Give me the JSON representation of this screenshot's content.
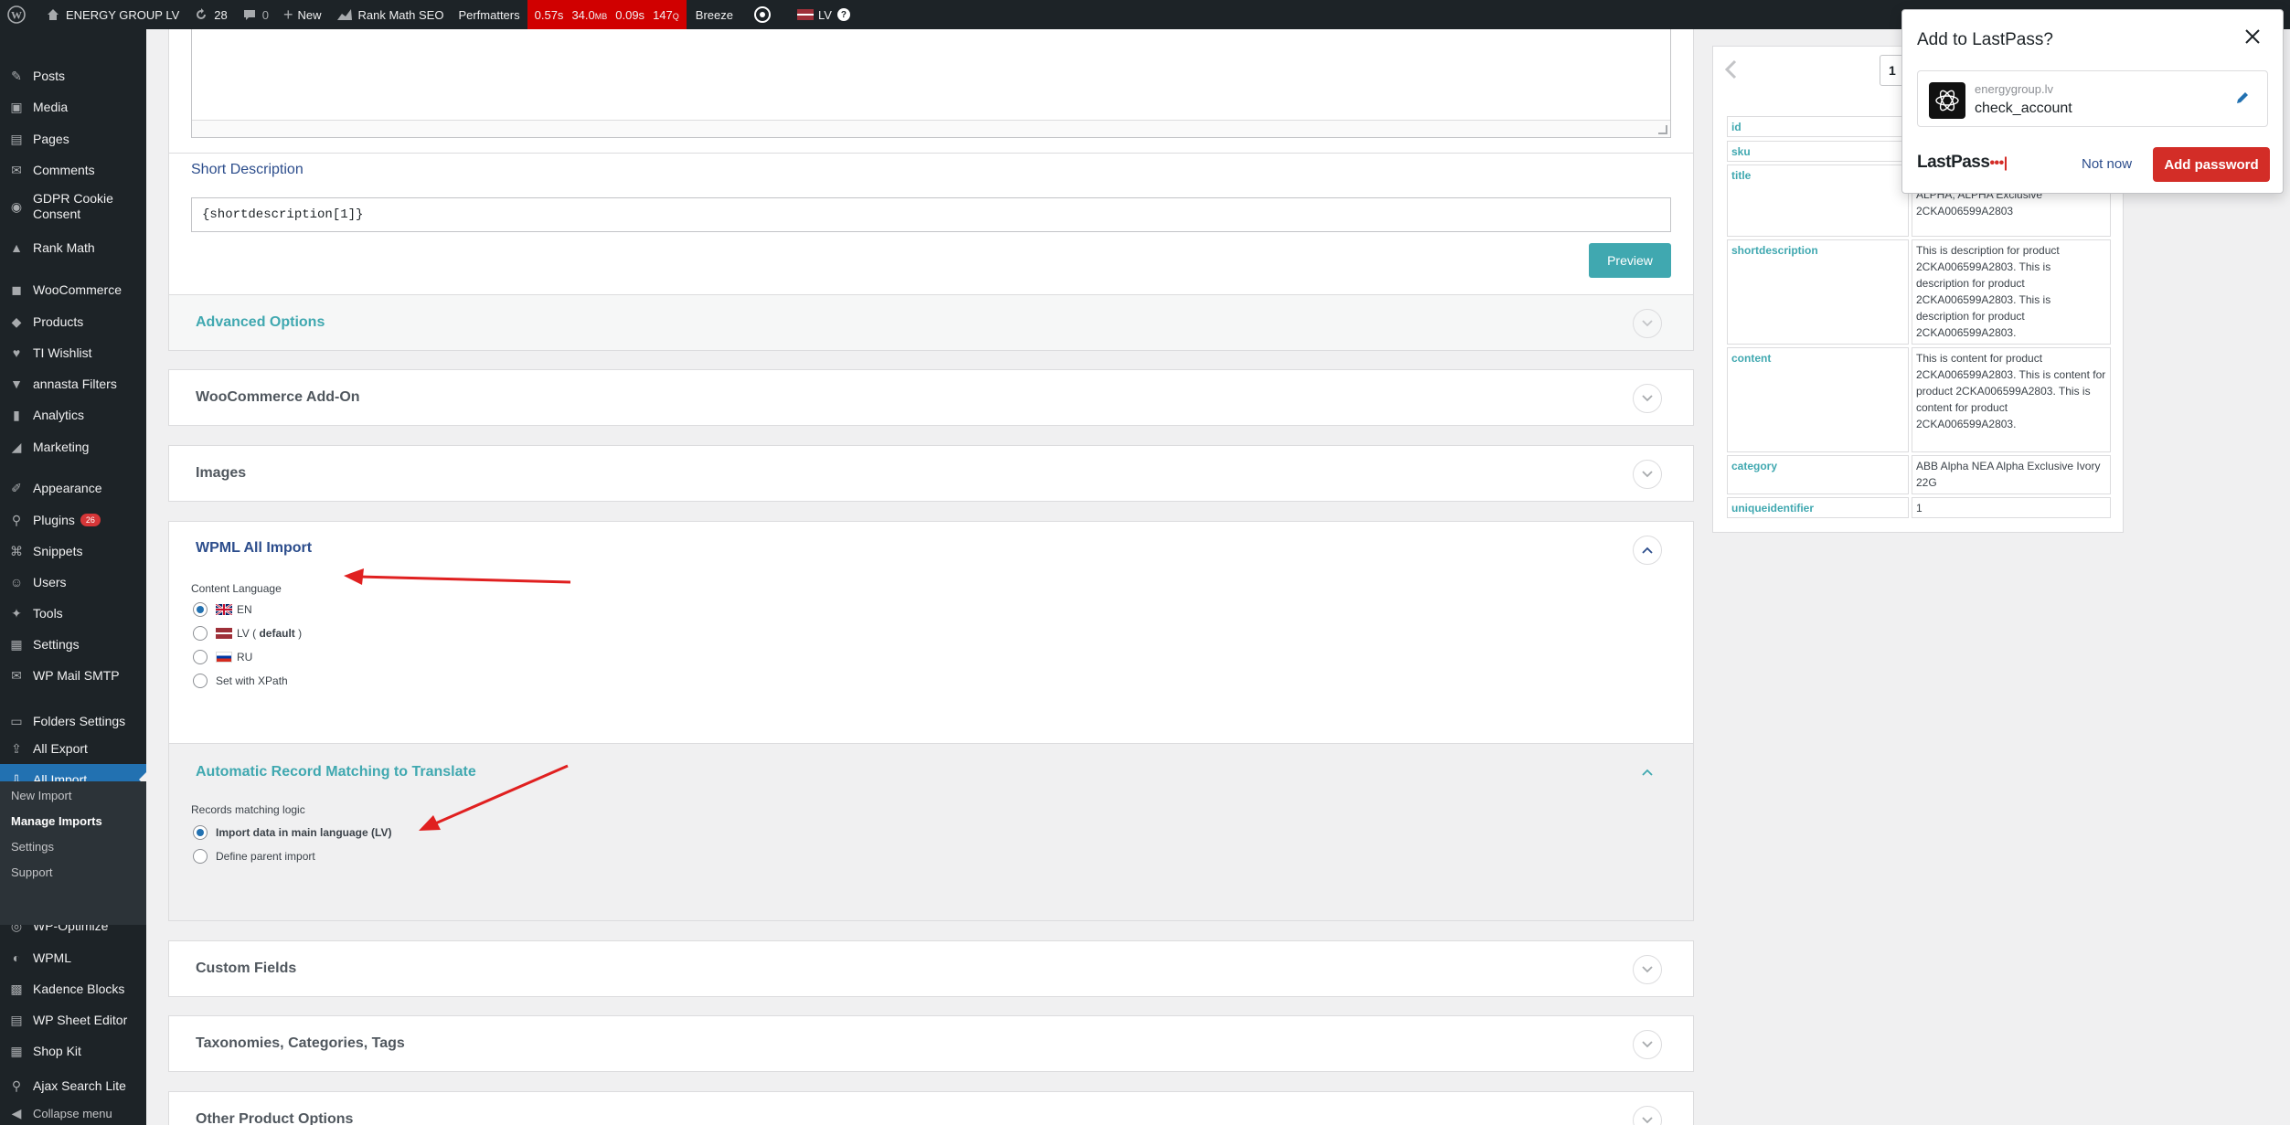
{
  "adminbar": {
    "site_name": "ENERGY GROUP LV",
    "updates_count": "28",
    "comments_count": "0",
    "new_label": "New",
    "rankmath_label": "Rank Math SEO",
    "perfmatters_label": "Perfmatters",
    "perf_time": "0.57s",
    "perf_mem": "34.0",
    "perf_mem_unit": "MB",
    "perf_query_time": "0.09s",
    "perf_queries": "147",
    "perf_queries_unit": "Q",
    "breeze_label": "Breeze",
    "lang_label": "LV"
  },
  "sidebar": {
    "items": [
      {
        "label": "Posts",
        "icon": "pin-icon"
      },
      {
        "label": "Media",
        "icon": "media-icon"
      },
      {
        "label": "Pages",
        "icon": "page-icon"
      },
      {
        "label": "Comments",
        "icon": "comment-icon"
      },
      {
        "label": "GDPR Cookie Consent",
        "icon": "cookie-icon"
      },
      {
        "label": "Rank Math",
        "icon": "rankmath-icon"
      },
      {
        "label": "WooCommerce",
        "icon": "woocommerce-icon"
      },
      {
        "label": "Products",
        "icon": "products-icon"
      },
      {
        "label": "TI Wishlist",
        "icon": "heart-icon"
      },
      {
        "label": "annasta Filters",
        "icon": "filter-icon"
      },
      {
        "label": "Analytics",
        "icon": "bar-chart-icon"
      },
      {
        "label": "Marketing",
        "icon": "megaphone-icon"
      },
      {
        "label": "Appearance",
        "icon": "brush-icon"
      },
      {
        "label": "Plugins",
        "icon": "plugin-icon",
        "badge": "26"
      },
      {
        "label": "Snippets",
        "icon": "snippets-icon"
      },
      {
        "label": "Users",
        "icon": "users-icon"
      },
      {
        "label": "Tools",
        "icon": "wrench-icon"
      },
      {
        "label": "Settings",
        "icon": "settings-icon"
      },
      {
        "label": "WP Mail SMTP",
        "icon": "mail-icon"
      },
      {
        "label": "Folders Settings",
        "icon": "folder-icon"
      },
      {
        "label": "All Export",
        "icon": "export-icon"
      },
      {
        "label": "All Import",
        "icon": "import-icon",
        "active": true
      },
      {
        "label": "WP-Optimize",
        "icon": "optimize-icon"
      },
      {
        "label": "WPML",
        "icon": "wpml-icon"
      },
      {
        "label": "Kadence Blocks",
        "icon": "kadence-icon"
      },
      {
        "label": "WP Sheet Editor",
        "icon": "sheet-icon"
      },
      {
        "label": "Shop Kit",
        "icon": "shop-icon"
      },
      {
        "label": "Ajax Search Lite",
        "icon": "search-icon"
      },
      {
        "label": "Collapse menu",
        "icon": "collapse-icon"
      }
    ],
    "submenu": [
      "New Import",
      "Manage Imports",
      "Settings",
      "Support"
    ]
  },
  "main": {
    "short_description_label": "Short Description",
    "short_description_value": "{shortdescription[1]}",
    "preview_button": "Preview",
    "sections": {
      "advanced": "Advanced Options",
      "woo_addon": "WooCommerce Add-On",
      "images": "Images",
      "wpml": "WPML All Import",
      "auto_match": "Automatic Record Matching to Translate",
      "custom_fields": "Custom Fields",
      "taxonomies": "Taxonomies, Categories, Tags",
      "other": "Other Product Options"
    },
    "content_language_label": "Content Language",
    "languages": [
      {
        "label": "EN",
        "checked": true,
        "flag": "uk"
      },
      {
        "label": "LV",
        "suffix": "default",
        "checked": false,
        "flag": "lv"
      },
      {
        "label": "RU",
        "checked": false,
        "flag": "ru"
      },
      {
        "label": "Set with XPath",
        "checked": false,
        "flag": ""
      }
    ],
    "records_matching_label": "Records matching logic",
    "matching_options": [
      {
        "label": "Import data in main language (LV)",
        "checked": true
      },
      {
        "label": "Define parent import",
        "checked": false
      }
    ]
  },
  "preview_table": {
    "page_number": "1",
    "rows": [
      {
        "key": "id",
        "value": ""
      },
      {
        "key": "sku",
        "value": ""
      },
      {
        "key": "title",
        "value": "ALPHA, ALPHA Exclusive 2CKA006599A2803"
      },
      {
        "key": "shortdescription",
        "value": "This is description for product 2CKA006599A2803. This is description for product 2CKA006599A2803. This is description for product 2CKA006599A2803."
      },
      {
        "key": "content",
        "value": "This is content for product 2CKA006599A2803. This is content for product 2CKA006599A2803. This is content for product 2CKA006599A2803."
      },
      {
        "key": "category",
        "value": "ABB Alpha NEA Alpha Exclusive Ivory 22G"
      },
      {
        "key": "uniqueidentifier",
        "value": "1"
      }
    ]
  },
  "lastpass": {
    "title": "Add to LastPass?",
    "site": "energygroup.lv",
    "username": "check_account",
    "logo_text": "LastPass",
    "not_now": "Not now",
    "add_password": "Add password"
  },
  "colors": {
    "sidebar_bg": "#1d2327",
    "active_blue": "#2271b1",
    "teal": "#40a8b0",
    "perf_red": "#d00000",
    "lastpass_red": "#d32d27",
    "annotation_red": "#e02020"
  }
}
